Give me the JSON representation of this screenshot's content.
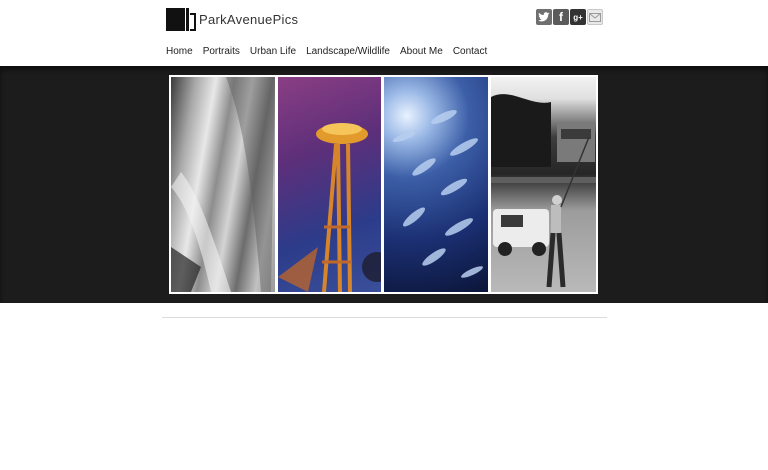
{
  "site": {
    "logo_text": "ParkAvenuePics"
  },
  "social": {
    "items": [
      {
        "icon": "twitter-icon"
      },
      {
        "icon": "facebook-icon",
        "glyph": "f"
      },
      {
        "icon": "google-plus-icon",
        "glyph": "g+"
      },
      {
        "icon": "mail-icon"
      }
    ]
  },
  "nav": {
    "items": [
      {
        "label": "Home"
      },
      {
        "label": "Portraits"
      },
      {
        "label": "Urban Life"
      },
      {
        "label": "Landscape/Wildlife"
      },
      {
        "label": "About Me"
      },
      {
        "label": "Contact"
      }
    ]
  },
  "gallery": {
    "panels": [
      {
        "subject": "ice-waterfall-photo"
      },
      {
        "subject": "space-needle-photo"
      },
      {
        "subject": "fish-school-photo"
      },
      {
        "subject": "fisherman-photo"
      }
    ]
  },
  "colors": {
    "banner_bg": "#1c1c1c",
    "page_bg": "#ffffff",
    "text": "#222222"
  }
}
